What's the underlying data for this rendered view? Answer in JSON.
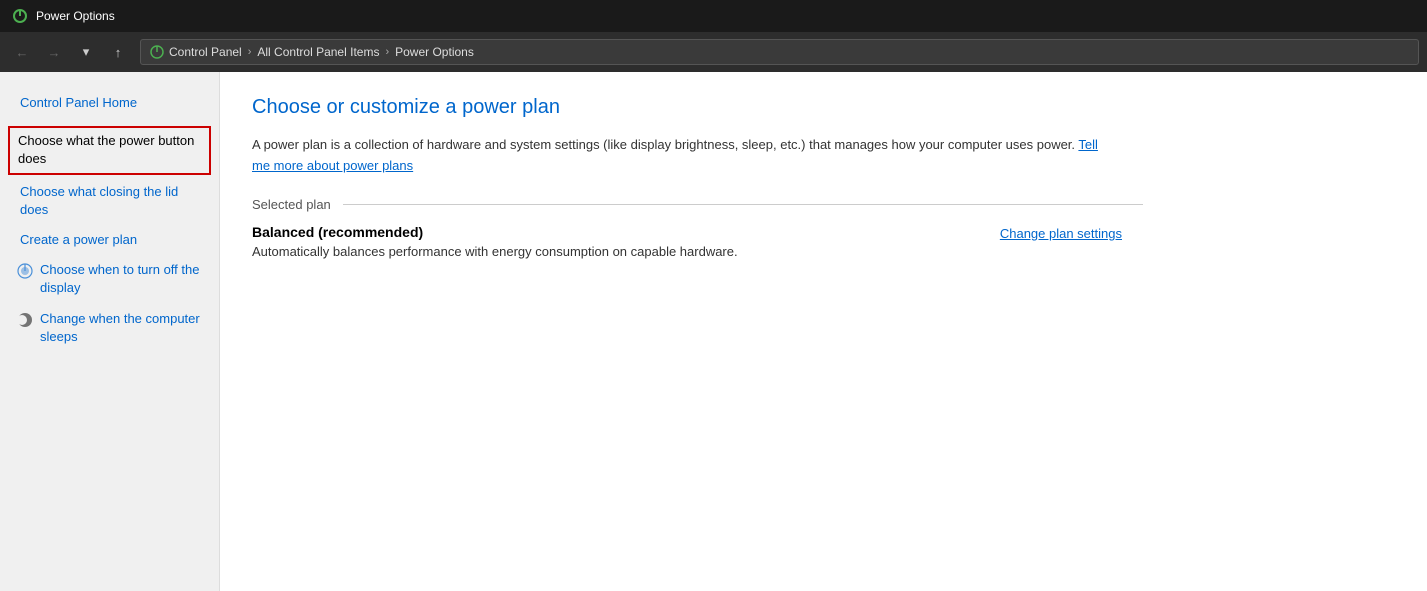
{
  "titleBar": {
    "iconAlt": "power-options-icon",
    "title": "Power Options"
  },
  "toolbar": {
    "backBtn": "←",
    "forwardBtn": "→",
    "dropdownBtn": "▾",
    "upBtn": "↑",
    "breadcrumbs": [
      {
        "label": "Control Panel",
        "sep": "›"
      },
      {
        "label": "All Control Panel Items",
        "sep": "›"
      },
      {
        "label": "Power Options",
        "sep": ""
      }
    ]
  },
  "sidebar": {
    "homeLabel": "Control Panel Home",
    "items": [
      {
        "id": "power-button",
        "label": "Choose what the power button does",
        "active": true,
        "hasIcon": false
      },
      {
        "id": "lid",
        "label": "Choose what closing the lid does",
        "active": false,
        "hasIcon": false
      },
      {
        "id": "create-plan",
        "label": "Create a power plan",
        "active": false,
        "hasIcon": false
      },
      {
        "id": "display-off",
        "label": "Choose when to turn off the display",
        "active": false,
        "hasIcon": true
      },
      {
        "id": "sleep",
        "label": "Change when the computer sleeps",
        "active": false,
        "hasIcon": true
      }
    ]
  },
  "content": {
    "title": "Choose or customize a power plan",
    "description": "A power plan is a collection of hardware and system settings (like display brightness, sleep, etc.) that manages how your computer uses power.",
    "learnMoreLink": "Tell me more about power plans",
    "selectedPlanLabel": "Selected plan",
    "planName": "Balanced (recommended)",
    "planDescription": "Automatically balances performance with energy consumption on capable hardware.",
    "changePlanSettings": "Change plan settings"
  }
}
